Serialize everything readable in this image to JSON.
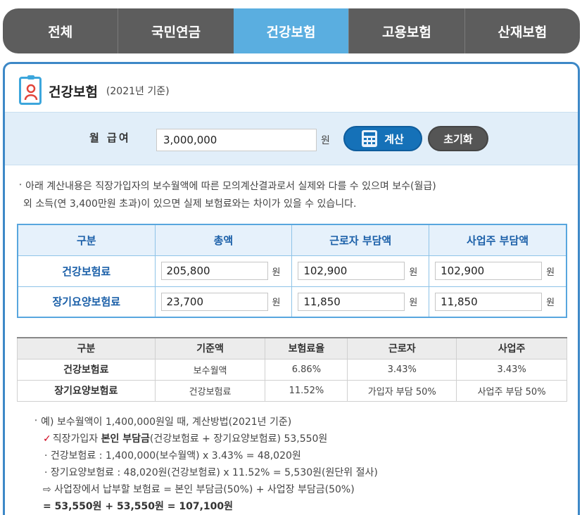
{
  "tabs": [
    "전체",
    "국민연금",
    "건강보험",
    "고용보험",
    "산재보험"
  ],
  "header": {
    "title": "건강보험",
    "subtitle": "(2021년 기준)"
  },
  "salary": {
    "label": "월 급여",
    "value": "3,000,000",
    "unit": "원",
    "calc_label": "계산",
    "reset_label": "초기화"
  },
  "note": {
    "line1": "아래 계산내용은 직장가입자의 보수월액에 따른 모의계산결과로서 실제와 다를 수 있으며 보수(월급)",
    "line2": "외 소득(연 3,400만원 초과)이 있으면 실제 보험료와는 차이가 있을 수 있습니다."
  },
  "result_table": {
    "headers": [
      "구분",
      "총액",
      "근로자 부담액",
      "사업주 부담액"
    ],
    "unit": "원",
    "rows": [
      {
        "label": "건강보험료",
        "total": "205,800",
        "worker": "102,900",
        "employer": "102,900"
      },
      {
        "label": "장기요양보험료",
        "total": "23,700",
        "worker": "11,850",
        "employer": "11,850"
      }
    ]
  },
  "rate_table": {
    "headers": [
      "구분",
      "기준액",
      "보험료율",
      "근로자",
      "사업주"
    ],
    "rows": [
      [
        "건강보험료",
        "보수월액",
        "6.86%",
        "3.43%",
        "3.43%"
      ],
      [
        "장기요양보험료",
        "건강보험료",
        "11.52%",
        "가입자 부담 50%",
        "사업주 부담 50%"
      ]
    ]
  },
  "example": {
    "intro": "예) 보수월액이 1,400,000원일 때, 계산방법(2021년 기준)",
    "check_mark": "✓",
    "line_a_pre": "직장가입자 ",
    "line_a_bold": "본인 부담금",
    "line_a_post": "(건강보험료 + 장기요양보험료) 53,550원",
    "line_b": "· 건강보험료 : 1,400,000(보수월액) x 3.43% = 48,020원",
    "line_c": "· 장기요양보험료 : 48,020원(건강보험료) x 11.52% = 5,530원(원단위 절사)",
    "line_d": "⇨ 사업장에서 납부할 보험료 = 본인 부담금(50%) + 사업장 부담금(50%)",
    "line_e": "= 53,550원 + 53,550원 = 107,100원"
  },
  "colors": {
    "tab_bg": "#5d5d5d",
    "tab_active": "#5aaee0",
    "panel_border": "#3d88c7",
    "calc_button": "#1571b8",
    "accent_text": "#1a5fa8",
    "check": "#d0021b"
  }
}
